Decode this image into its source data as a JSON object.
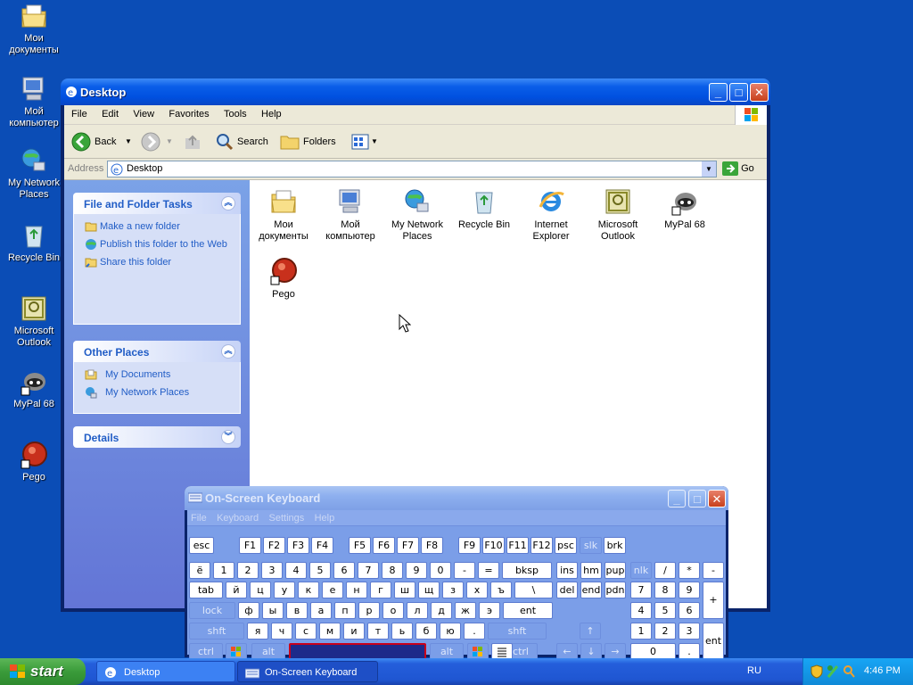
{
  "desktop": {
    "icons": [
      {
        "label": "Мои документы",
        "icon": "my-documents-icon"
      },
      {
        "label": "Мой компьютер",
        "icon": "my-computer-icon"
      },
      {
        "label": "My Network Places",
        "icon": "network-places-icon"
      },
      {
        "label": "Recycle Bin",
        "icon": "recycle-bin-icon"
      },
      {
        "label": "Microsoft Outlook",
        "icon": "outlook-icon"
      },
      {
        "label": "MyPal 68",
        "icon": "mypal-icon"
      },
      {
        "label": "Pego",
        "icon": "pego-icon"
      }
    ]
  },
  "explorer": {
    "title": "Desktop",
    "menu": [
      "File",
      "Edit",
      "View",
      "Favorites",
      "Tools",
      "Help"
    ],
    "toolbar": {
      "back": "Back",
      "search": "Search",
      "folders": "Folders"
    },
    "address": {
      "label": "Address",
      "value": "Desktop",
      "go": "Go"
    },
    "tasks_panel": {
      "title": "File and Folder Tasks",
      "items": [
        "Make a new folder",
        "Publish this folder to the Web",
        "Share this folder"
      ]
    },
    "places_panel": {
      "title": "Other Places",
      "items": [
        "My Documents",
        "My Network Places"
      ]
    },
    "details_panel": {
      "title": "Details"
    },
    "files": [
      {
        "label": "Мои документы",
        "icon": "my-documents-icon"
      },
      {
        "label": "Мой компьютер",
        "icon": "my-computer-icon"
      },
      {
        "label": "My Network Places",
        "icon": "network-places-icon"
      },
      {
        "label": "Recycle Bin",
        "icon": "recycle-bin-icon"
      },
      {
        "label": "Internet Explorer",
        "icon": "internet-explorer-icon"
      },
      {
        "label": "Microsoft Outlook",
        "icon": "outlook-icon"
      },
      {
        "label": "MyPal 68",
        "icon": "mypal-icon"
      },
      {
        "label": "Pego",
        "icon": "pego-icon"
      }
    ]
  },
  "osk": {
    "title": "On-Screen Keyboard",
    "menu": [
      "File",
      "Keyboard",
      "Settings",
      "Help"
    ],
    "row_fn": [
      "esc",
      "F1",
      "F2",
      "F3",
      "F4",
      "F5",
      "F6",
      "F7",
      "F8",
      "F9",
      "F10",
      "F11",
      "F12",
      "psc",
      "slk",
      "brk"
    ],
    "row1": [
      "ё",
      "1",
      "2",
      "3",
      "4",
      "5",
      "6",
      "7",
      "8",
      "9",
      "0",
      "-",
      "=",
      "bksp",
      "ins",
      "hm",
      "pup",
      "nlk",
      "/",
      "*",
      "-"
    ],
    "row2": [
      "tab",
      "й",
      "ц",
      "у",
      "к",
      "е",
      "н",
      "г",
      "ш",
      "щ",
      "з",
      "х",
      "ъ",
      "\\",
      "del",
      "end",
      "pdn",
      "7",
      "8",
      "9",
      "+"
    ],
    "row3": [
      "lock",
      "ф",
      "ы",
      "в",
      "а",
      "п",
      "р",
      "о",
      "л",
      "д",
      "ж",
      "э",
      "ent",
      "4",
      "5",
      "6"
    ],
    "row4": [
      "shft",
      "я",
      "ч",
      "с",
      "м",
      "и",
      "т",
      "ь",
      "б",
      "ю",
      ".",
      "shft",
      "↑",
      "1",
      "2",
      "3",
      "ent"
    ],
    "row5": [
      "ctrl",
      "alt",
      "alt",
      "ctrl",
      "←",
      "↓",
      "→",
      "0",
      "."
    ]
  },
  "taskbar": {
    "start": "start",
    "tasks": [
      "Desktop",
      "On-Screen Keyboard"
    ],
    "language": "RU",
    "clock": "4:46 PM"
  }
}
